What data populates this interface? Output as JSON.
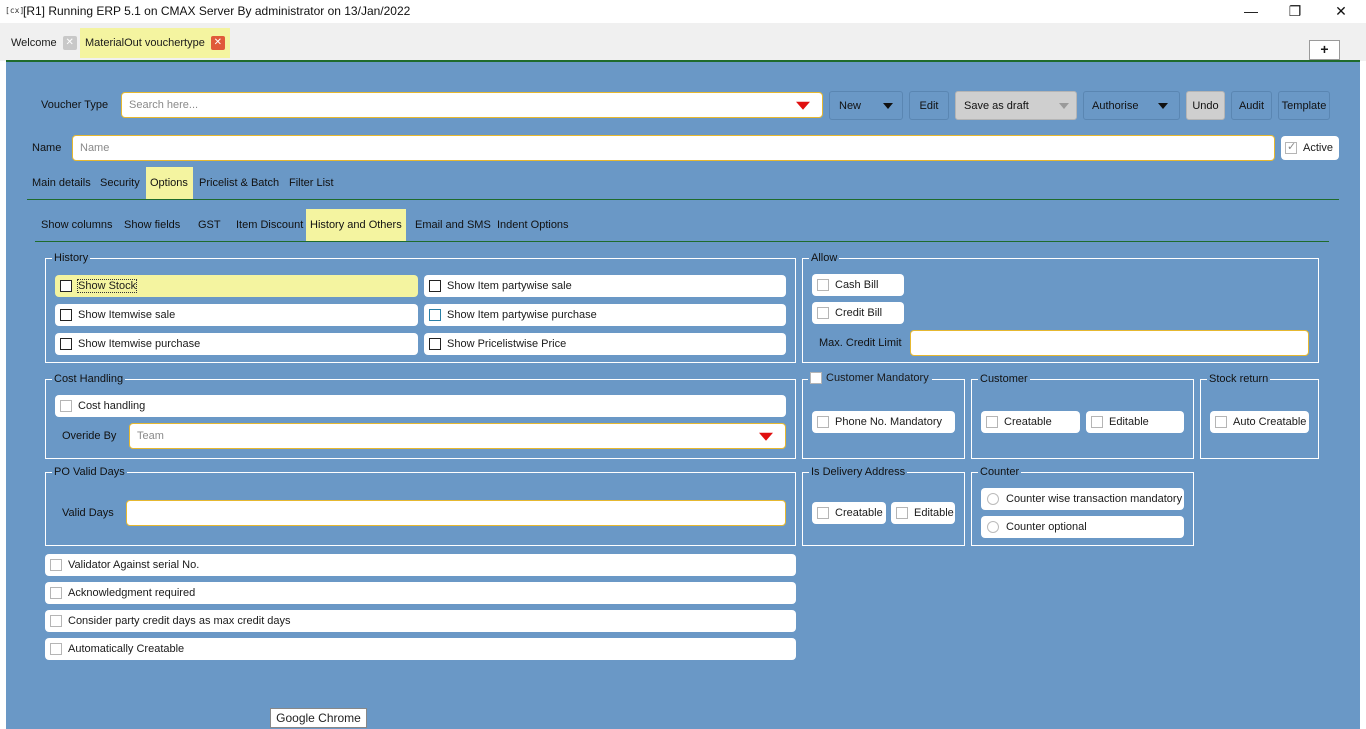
{
  "window": {
    "title": "[R1] Running ERP 5.1 on CMAX Server By administrator on 13/Jan/2022",
    "app_icon_text": "[cx]",
    "minimize": "—",
    "restore": "❐",
    "close": "✕"
  },
  "tabs": [
    {
      "label": "Welcome",
      "close": "✕"
    },
    {
      "label": "MaterialOut vouchertype",
      "close": "✕"
    }
  ],
  "new_tab": "+",
  "toolbar": {
    "voucher_type_label": "Voucher Type",
    "voucher_type_placeholder": "Search here...",
    "new": "New",
    "edit": "Edit",
    "save_as_draft": "Save as draft",
    "authorise": "Authorise",
    "undo": "Undo",
    "audit": "Audit",
    "template": "Template"
  },
  "name_row": {
    "label": "Name",
    "placeholder": "Name",
    "active_label": "Active",
    "active_checked": true
  },
  "main_tabs": [
    "Main details",
    "Security",
    "Options",
    "Pricelist & Batch",
    "Filter List"
  ],
  "sub_tabs": [
    "Show columns",
    "Show fields",
    "GST",
    "Item Discount",
    "History and Others",
    "Email and SMS",
    "Indent Options"
  ],
  "history": {
    "title": "History",
    "items": [
      "Show Stock",
      "Show Item partywise sale",
      "Show Itemwise sale",
      "Show Item partywise purchase",
      "Show Itemwise purchase",
      "Show Pricelistwise Price"
    ]
  },
  "allow": {
    "title": "Allow",
    "cash_bill": "Cash Bill",
    "credit_bill": "Credit Bill",
    "max_credit_limit": "Max. Credit Limit"
  },
  "cost_handling": {
    "title": "Cost Handling",
    "checkbox": "Cost handling",
    "override_label": "Overide By",
    "override_placeholder": "Team"
  },
  "customer_mandatory": {
    "title": "Customer Mandatory",
    "phone": "Phone No. Mandatory"
  },
  "customer": {
    "title": "Customer",
    "creatable": "Creatable",
    "editable": "Editable"
  },
  "stock_return": {
    "title": "Stock return",
    "auto_creatable": "Auto Creatable"
  },
  "po_valid": {
    "title": "PO Valid Days",
    "label": "Valid Days"
  },
  "delivery": {
    "title": "Is Delivery Address",
    "creatable": "Creatable",
    "editable": "Editable"
  },
  "counter": {
    "title": "Counter",
    "opt1": "Counter wise transaction mandatory",
    "opt2": "Counter optional"
  },
  "bottom_checks": [
    "Validator Against serial No.",
    "Acknowledgment required",
    "Consider party credit days as max credit days",
    "Automatically Creatable"
  ],
  "tooltip": "Google Chrome",
  "colors": {
    "panel": "#6a98c6",
    "highlight": "#f4f4a0",
    "accent_line": "#1f6b2c",
    "dropdown_arrow": "#e01010",
    "tab_close": "#e05a3a"
  }
}
